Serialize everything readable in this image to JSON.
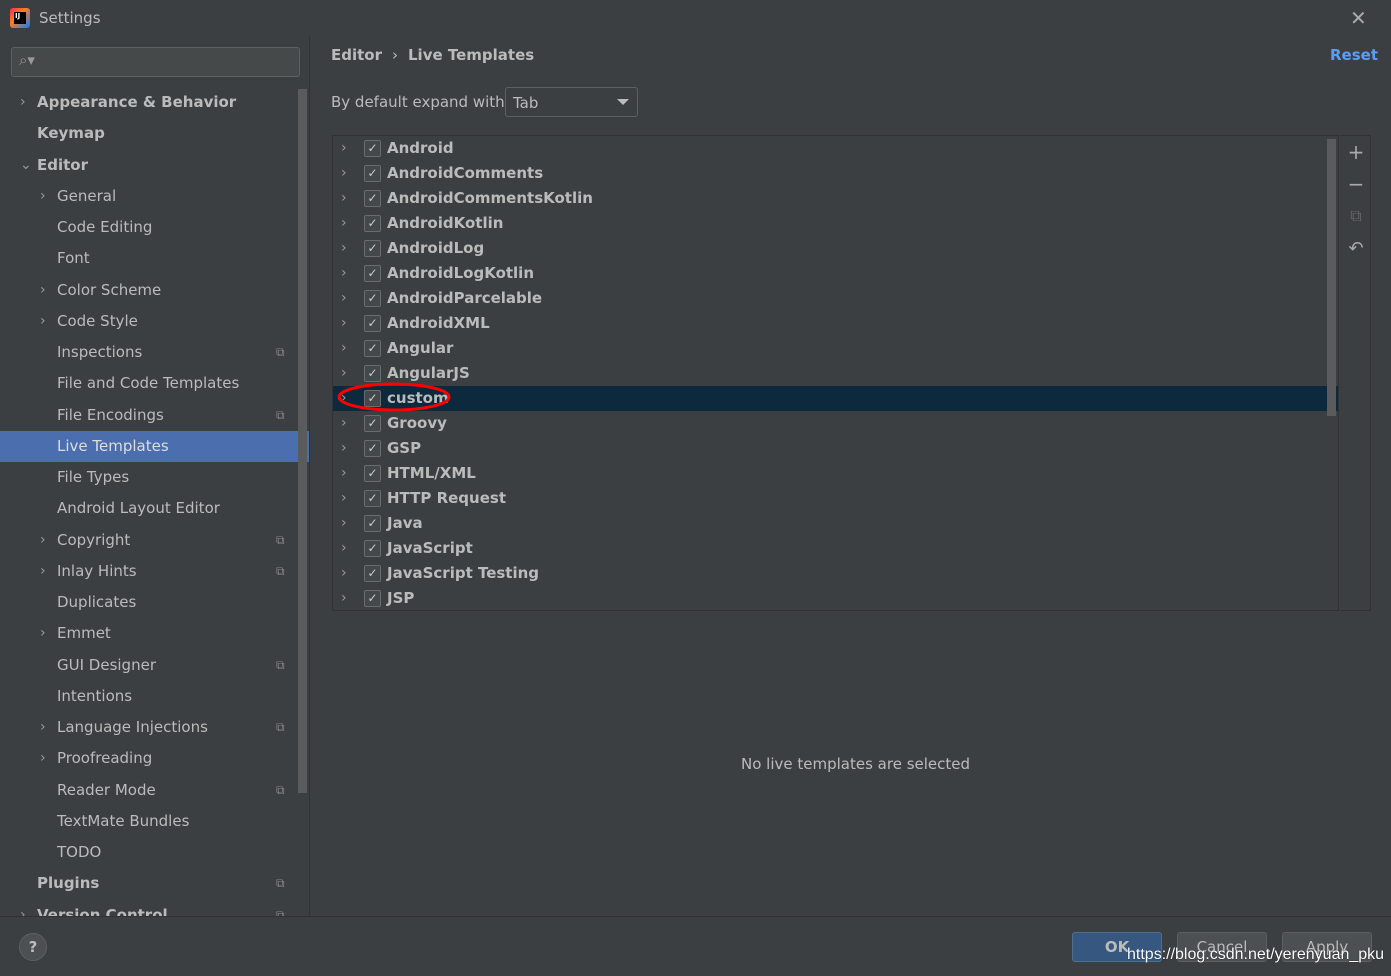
{
  "window": {
    "title": "Settings",
    "close_icon": "close-icon"
  },
  "search": {
    "placeholder": "",
    "icon": "search-icon"
  },
  "sidebar": {
    "items": [
      {
        "label": "Appearance & Behavior",
        "level": 0,
        "chevron": "right",
        "bold": true
      },
      {
        "label": "Keymap",
        "level": 0,
        "bold": true
      },
      {
        "label": "Editor",
        "level": 0,
        "chevron": "down",
        "bold": true
      },
      {
        "label": "General",
        "level": 1,
        "chevron": "right"
      },
      {
        "label": "Code Editing",
        "level": 1
      },
      {
        "label": "Font",
        "level": 1
      },
      {
        "label": "Color Scheme",
        "level": 1,
        "chevron": "right"
      },
      {
        "label": "Code Style",
        "level": 1,
        "chevron": "right"
      },
      {
        "label": "Inspections",
        "level": 1,
        "project": true
      },
      {
        "label": "File and Code Templates",
        "level": 1
      },
      {
        "label": "File Encodings",
        "level": 1,
        "project": true
      },
      {
        "label": "Live Templates",
        "level": 1,
        "selected": true
      },
      {
        "label": "File Types",
        "level": 1
      },
      {
        "label": "Android Layout Editor",
        "level": 1
      },
      {
        "label": "Copyright",
        "level": 1,
        "chevron": "right",
        "project": true
      },
      {
        "label": "Inlay Hints",
        "level": 1,
        "chevron": "right",
        "project": true
      },
      {
        "label": "Duplicates",
        "level": 1
      },
      {
        "label": "Emmet",
        "level": 1,
        "chevron": "right"
      },
      {
        "label": "GUI Designer",
        "level": 1,
        "project": true
      },
      {
        "label": "Intentions",
        "level": 1
      },
      {
        "label": "Language Injections",
        "level": 1,
        "chevron": "right",
        "project": true
      },
      {
        "label": "Proofreading",
        "level": 1,
        "chevron": "right"
      },
      {
        "label": "Reader Mode",
        "level": 1,
        "project": true
      },
      {
        "label": "TextMate Bundles",
        "level": 1
      },
      {
        "label": "TODO",
        "level": 1
      },
      {
        "label": "Plugins",
        "level": 0,
        "bold": true,
        "project": true
      },
      {
        "label": "Version Control",
        "level": 0,
        "chevron": "right",
        "bold": true,
        "project": true
      }
    ]
  },
  "breadcrumb": {
    "parent": "Editor",
    "separator": "›",
    "current": "Live Templates"
  },
  "reset_label": "Reset",
  "expand": {
    "label": "By default expand with",
    "value": "Tab"
  },
  "templates": [
    {
      "label": "Android",
      "checked": true
    },
    {
      "label": "AndroidComments",
      "checked": true
    },
    {
      "label": "AndroidCommentsKotlin",
      "checked": true
    },
    {
      "label": "AndroidKotlin",
      "checked": true
    },
    {
      "label": "AndroidLog",
      "checked": true
    },
    {
      "label": "AndroidLogKotlin",
      "checked": true
    },
    {
      "label": "AndroidParcelable",
      "checked": true
    },
    {
      "label": "AndroidXML",
      "checked": true
    },
    {
      "label": "Angular",
      "checked": true
    },
    {
      "label": "AngularJS",
      "checked": true
    },
    {
      "label": "custom",
      "checked": true,
      "selected": true,
      "annotated": true
    },
    {
      "label": "Groovy",
      "checked": true
    },
    {
      "label": "GSP",
      "checked": true
    },
    {
      "label": "HTML/XML",
      "checked": true
    },
    {
      "label": "HTTP Request",
      "checked": true
    },
    {
      "label": "Java",
      "checked": true
    },
    {
      "label": "JavaScript",
      "checked": true
    },
    {
      "label": "JavaScript Testing",
      "checked": true
    },
    {
      "label": "JSP",
      "checked": true
    }
  ],
  "toolbar": [
    "plus-icon",
    "minus-icon",
    "copy-icon",
    "revert-icon"
  ],
  "empty_message": "No live templates are selected",
  "buttons": {
    "help": "?",
    "ok": "OK",
    "cancel": "Cancel",
    "apply": "Apply"
  },
  "watermark": "https://blog.csdn.net/yerenyuan_pku",
  "colors": {
    "selection": "#4b6eaf",
    "list_selection": "#0d293e",
    "link": "#589df6",
    "annotation": "#ff0000"
  }
}
